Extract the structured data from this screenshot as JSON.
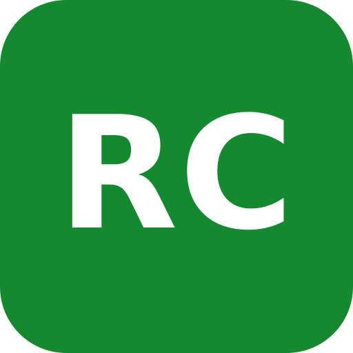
{
  "icon": {
    "initials": "RC",
    "background_color": "#14892f",
    "text_color": "#ffffff"
  }
}
